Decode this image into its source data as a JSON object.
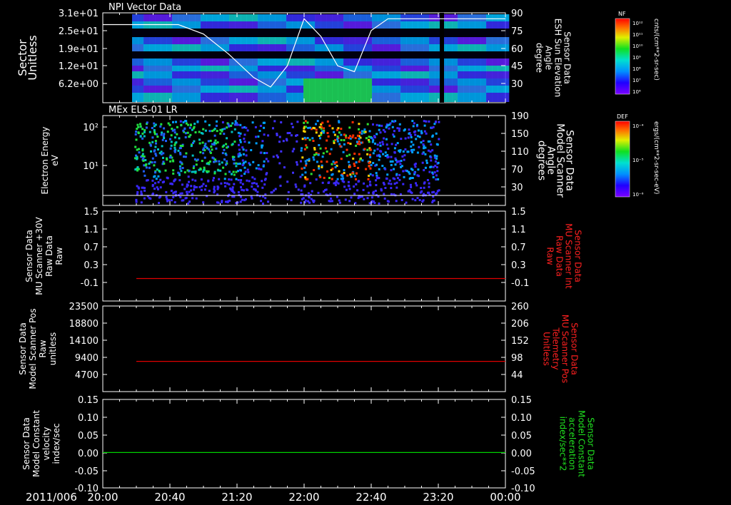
{
  "chart_data": [
    {
      "type": "heatmap",
      "title": "NPI Vector Data",
      "ylabel_left": [
        "Sector",
        "Unitless"
      ],
      "yticks_left": [
        "3.1e+01",
        "2.5e+01",
        "1.9e+01",
        "1.2e+01",
        "6.2e+00"
      ],
      "ylabel_right": [
        "Sensor Data",
        "ESH Sun Elevation",
        "Angle",
        "degree"
      ],
      "yticks_right": [
        "90",
        "75",
        "60",
        "45",
        "30"
      ],
      "overlay_line": {
        "name": "ESH Sun Elevation Angle",
        "x": [
          "20:00",
          "20:45",
          "21:00",
          "21:15",
          "21:30",
          "21:40",
          "21:50",
          "22:00",
          "22:10",
          "22:20",
          "22:30",
          "22:40",
          "22:50",
          "23:00",
          "23:30",
          "00:00"
        ],
        "y": [
          80,
          80,
          72,
          55,
          35,
          27,
          45,
          85,
          70,
          45,
          40,
          75,
          85,
          85,
          85,
          85
        ]
      },
      "colorbar": {
        "label": "NF",
        "units": "cnts/(cm**2-sr-sec)",
        "ticks": [
          "10¹²",
          "10¹¹",
          "10¹⁰",
          "10⁹",
          "10⁸",
          "10⁷",
          "10⁶"
        ]
      }
    },
    {
      "type": "heatmap",
      "title": "MEx ELS-01 LR",
      "ylabel_left": [
        "Electron Energy",
        "eV"
      ],
      "yticks_left": [
        "10²",
        "10¹"
      ],
      "ylabel_right": [
        "Sensor Data",
        "Model Scanner",
        "Angle",
        "degrees"
      ],
      "yticks_right": [
        "190",
        "150",
        "110",
        "70",
        "30"
      ],
      "colorbar": {
        "label": "DEF",
        "units": "ergs/(cm**2-sr-sec-eV)",
        "ticks": [
          "10⁻⁴",
          "10⁻⁵",
          "10⁻⁶"
        ]
      }
    },
    {
      "type": "line",
      "ylabel_left": [
        "Sensor Data",
        "MU Scanner +30V",
        "Raw Data",
        "Raw"
      ],
      "yticks_left": [
        "1.5",
        "1.1",
        "0.7",
        "0.3",
        "-0.1"
      ],
      "ylim_left": [
        -0.5,
        1.5
      ],
      "ylabel_right": [
        "Sensor Data",
        "MU Scanner Int",
        "Raw Data",
        "Raw"
      ],
      "yticks_right": [
        "1.5",
        "1.1",
        "0.7",
        "0.3",
        "-0.1"
      ],
      "series": [
        {
          "x": [
            "20:20",
            "00:00"
          ],
          "y": [
            0.0,
            0.0
          ],
          "color": "#e00000"
        }
      ]
    },
    {
      "type": "line",
      "ylabel_left": [
        "Sensor Data",
        "Model Scanner Pos",
        "Raw",
        "unitless"
      ],
      "yticks_left": [
        "23500",
        "18800",
        "14100",
        "9400",
        "4700"
      ],
      "ylim_left": [
        0,
        23500
      ],
      "ylabel_right": [
        "Sensor Data",
        "MU Scanner Pos",
        "Telemetry",
        "Unitless"
      ],
      "yticks_right": [
        "260",
        "206",
        "152",
        "98",
        "44"
      ],
      "series": [
        {
          "x": [
            "20:20",
            "00:00"
          ],
          "y": [
            8300,
            8300
          ],
          "color": "#e00000"
        }
      ]
    },
    {
      "type": "line",
      "ylabel_left": [
        "Sensor Data",
        "Model Constant",
        "velocity",
        "index/sec"
      ],
      "yticks_left": [
        "0.15",
        "0.10",
        "0.05",
        "0.00",
        "-0.05",
        "-0.10"
      ],
      "ylim_left": [
        -0.1,
        0.15
      ],
      "ylabel_right": [
        "Sensor Data",
        "Model Constant",
        "acceleration",
        "index/sec**2"
      ],
      "yticks_right": [
        "0.15",
        "0.10",
        "0.05",
        "0.00",
        "-0.05",
        "-0.10"
      ],
      "series": [
        {
          "x": [
            "20:00",
            "00:00"
          ],
          "y": [
            0.0,
            0.0
          ],
          "color": "#00d000"
        }
      ]
    }
  ],
  "xaxis": {
    "date": "2011/006",
    "ticks": [
      "20:00",
      "20:40",
      "21:20",
      "22:00",
      "22:40",
      "23:20",
      "00:00"
    ],
    "range": [
      "20:00",
      "00:00"
    ]
  },
  "colors": {
    "background": "#000000",
    "axes": "#ffffff",
    "red_label": "#ff2020",
    "green_label": "#20e020"
  }
}
